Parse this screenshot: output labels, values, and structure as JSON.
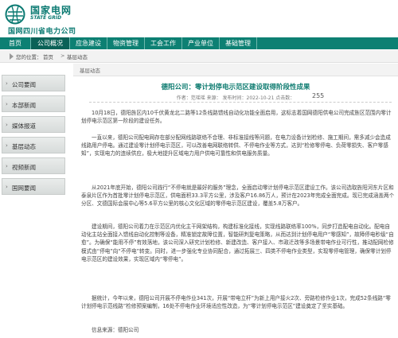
{
  "brand": {
    "name_cn": "国家电网",
    "name_en": "STATE GRID",
    "subsidiary": "国网四川省电力公司",
    "brand_color": "#0d8073"
  },
  "nav": {
    "items": [
      {
        "label": "首页",
        "active": false
      },
      {
        "label": "公司概况",
        "active": true
      },
      {
        "label": "应急建设",
        "active": false
      },
      {
        "label": "物资管理",
        "active": false
      },
      {
        "label": "工会工作",
        "active": false
      },
      {
        "label": "产业单位",
        "active": false
      },
      {
        "label": "基础管理",
        "active": false
      }
    ]
  },
  "breadcrumb": {
    "label": "您的位置：",
    "home": "首页",
    "separator": ">",
    "current": "基层动态"
  },
  "sidebar": {
    "items": [
      {
        "label": "公司要闻"
      },
      {
        "label": "本部新闻"
      },
      {
        "label": "媒体报道"
      },
      {
        "label": "基层动态"
      },
      {
        "label": "视频新闻"
      },
      {
        "label": "国网要闻"
      }
    ]
  },
  "article": {
    "section_tab": "基层动态",
    "title": "德阳公司：零计划停电示范区建设取得阶段性成果",
    "meta": "作者：范瑶瑶   来源：   发布时间：2022-10-21   点击数：",
    "views": "255",
    "paragraphs": [
      "10月18日，德阳旌区内10千伏黄龙北二路等12条线路馈线自动化功能全面启用，这标志着国网德阳供电公司完成旌区范围内零计划停电示范区第一阶段的建设任务。",
      "一直以来，德阳公司配电网存在部分配网线路联络不合理、非标准接线等问题，在电力设备计划检修、施工期间，需多减少会造成线路用户停电。通过建设零计划停电示范区，可以改善电网联络转供、不停电作业等方式，达到“检修零停电、负荷零损失、客户零感知”，实现电力的连续供应，极大地提升区域电力用户供电可靠性和供电服务质量。",
      "从2021年底开始，德阳公司践行“不停电就是最好的服务”理念，全面启动零计划停电示范区建设工作。该公司选取旌阳河东片区和泰泉片区作为首批零计划停电示范区，供电面积33.3平方公里，涉及客户16.86万人，预计在2023年完成全面完成。现已完成涵盖两个分区、文德国际会展中心等5.6平方公里的核心文化区域的零停电示范区建设，覆盖5.8万客户。",
      "建设期间，德阳公司着力在示范区内优化主干网架结构，构建标准化接线，实现线路联络率100%，同步打造配电自动化。配电自动化主站全面接入馈线自动化控制等设备，精准锁定故障位置，智能研判复电策略，从而达到计划停电用户“零感知”，故障停电秒级“自愈”。为确保“能用不停”有效落地，该公司深入研究计划检修、新建改造、客户接入、市政迁改等多场景带电作业可行性，推动配网检修模式由“停电”向“不停电”转变。同时，进一步强化专业协同配合，通过拓展三、四类不停电作业类型，实现零停电管理，确保零计划停电示范区的建设效果，实现区域内“零停电”。",
      "据统计，今年以来，德阳公司开展不停电作业341次，开展“带电立杆”为新上用户接火2次、旁路检修作业1次，完成52条线路“零计划停电示范线路”检修预案编制，16处不停电作业环境适应性改造，为“零计划停电示范区”建设奠定了坚实基础。",
      "信息来源：德阳公司"
    ]
  }
}
